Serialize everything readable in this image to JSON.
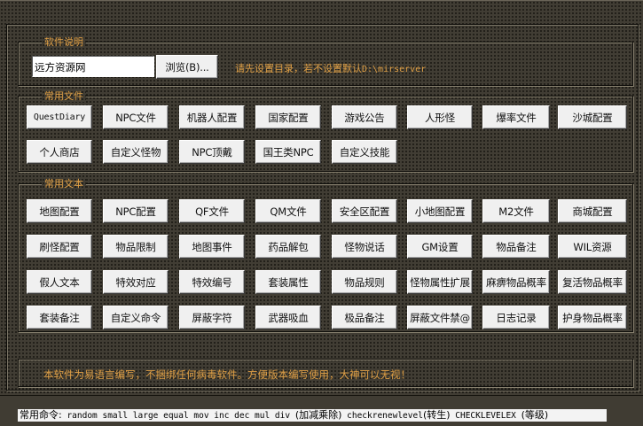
{
  "software_info": {
    "legend": "软件说明",
    "path_value": "远方资源网",
    "browse_label": "浏览(B)...",
    "hint_text": "请先设置目录，若不设置默认",
    "hint_path": "D:\\mirserver"
  },
  "common_files": {
    "legend": "常用文件",
    "buttons": [
      "QuestDiary",
      "NPC文件",
      "机器人配置",
      "国家配置",
      "游戏公告",
      "人形怪",
      "爆率文件",
      "沙城配置",
      "个人商店",
      "自定义怪物",
      "NPC顶戴",
      "国王类NPC",
      "自定义技能"
    ]
  },
  "common_texts": {
    "legend": "常用文本",
    "buttons": [
      "地图配置",
      "NPC配置",
      "QF文件",
      "QM文件",
      "安全区配置",
      "小地图配置",
      "M2文件",
      "商城配置",
      "刷怪配置",
      "物品限制",
      "地图事件",
      "药品解包",
      "怪物说话",
      "GM设置",
      "物品备注",
      "WIL资源",
      "假人文本",
      "特效对应",
      "特效编号",
      "套装属性",
      "物品规则",
      "怪物属性扩展",
      "麻痹物品概率",
      "复活物品概率",
      "套装备注",
      "自定义命令",
      "屏蔽字符",
      "武器吸血",
      "极品备注",
      "屏蔽文件禁@",
      "日志记录",
      "护身物品概率"
    ]
  },
  "footer_note": "本软件为易语言编写，不捆绑任何病毒软件。方便版本编写使用，大神可以无视！",
  "statusbar": {
    "prefix": "常用命令:",
    "commands": " random small large equal mov inc dec mul div ",
    "paren1": "(加减乘除)",
    "cmd2": " checkrenewlevel",
    "paren2": "(转生)",
    "cmd3": "  CHECKLEVELEX ",
    "paren3": "(等级)"
  },
  "colors": {
    "background": "#403c33",
    "accent_text": "#e0a046",
    "button_face": "#f0f0f0"
  }
}
